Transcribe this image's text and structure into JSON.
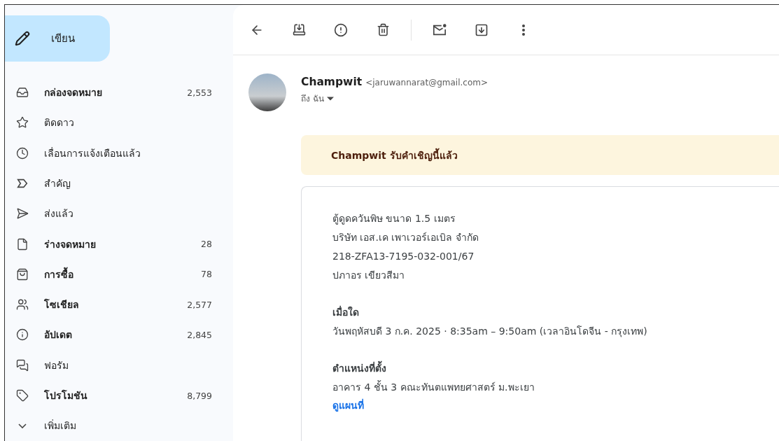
{
  "sidebar": {
    "compose": {
      "label": "เขียน"
    },
    "items": [
      {
        "label": "กล่องจดหมาย",
        "count": "2,553",
        "unread": true
      },
      {
        "label": "ติดดาว",
        "unread": false
      },
      {
        "label": "เลื่อนการแจ้งเตือนแล้ว",
        "unread": false
      },
      {
        "label": "สำคัญ",
        "unread": false
      },
      {
        "label": "ส่งแล้ว",
        "unread": false
      },
      {
        "label": "ร่างจดหมาย",
        "count": "28",
        "unread": true
      },
      {
        "label": "การซื้อ",
        "count": "78",
        "unread": true
      },
      {
        "label": "โซเชียล",
        "count": "2,577",
        "unread": true
      },
      {
        "label": "อัปเดต",
        "count": "2,845",
        "unread": true
      },
      {
        "label": "ฟอรัม",
        "unread": false
      },
      {
        "label": "โปรโมชัน",
        "count": "8,799",
        "unread": true
      },
      {
        "label": "เพิ่มเติม",
        "unread": false
      }
    ]
  },
  "message": {
    "sender_name": "Champwit",
    "sender_email": "<jaruwannarat@gmail.com>",
    "recipient": "ถึง ฉัน",
    "banner": "Champwit รับคำเชิญนี้แล้ว",
    "details": [
      "ตู้ดูดควันพิษ ขนาด 1.5 เมตร",
      "บริษัท เอส.เค เพาเวอร์เอเบิล จำกัด",
      "218-ZFA13-7195-032-001/67",
      "ปภาอร เขียวสีมา"
    ],
    "sections": [
      {
        "heading": "เมื่อใด",
        "text": "วันพฤหัสบดี 3 ก.ค. 2025 · 8:35am – 9:50am (เวลาอินโดจีน - กรุงเทพ)"
      },
      {
        "heading": "ตำแหน่งที่ตั้ง",
        "text": "อาคาร 4 ชั้น 3 คณะทันตแพทยศาสตร์ ม.พะเยา",
        "link": "ดูแผนที่"
      }
    ]
  }
}
